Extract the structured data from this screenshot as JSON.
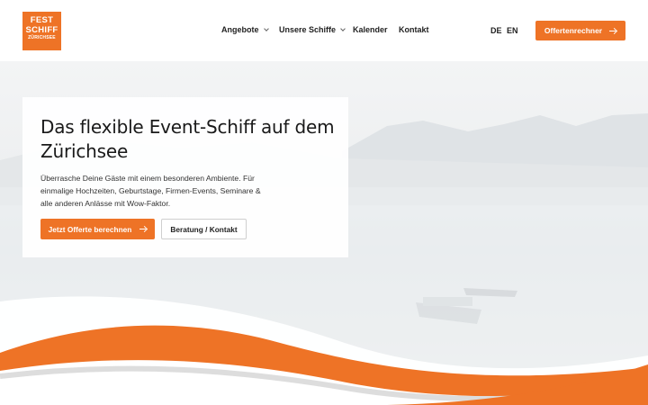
{
  "logo": {
    "line1": "FEST",
    "line2": "SCHIFF",
    "line3": "ZÜRICHSEE"
  },
  "nav": {
    "items": [
      {
        "label": "Angebote",
        "dropdown": true
      },
      {
        "label": "Unsere Schiffe",
        "dropdown": true
      },
      {
        "label": "Kalender",
        "dropdown": false
      },
      {
        "label": "Kontakt",
        "dropdown": false
      }
    ]
  },
  "languages": [
    "DE",
    "EN"
  ],
  "header_cta": "Offertenrechner",
  "hero": {
    "title": "Das flexible Event-Schiff auf dem Zürichsee",
    "text": "Überrasche Deine Gäste mit einem besonderen Ambiente. Für einmalige Hochzeiten, Geburtstage, Firmen-Events, Seminare & alle anderen Anlässe mit Wow-Faktor.",
    "primary_button": "Jetzt Offerte berechnen",
    "secondary_button": "Beratung / Kontakt"
  },
  "colors": {
    "accent": "#ee7326",
    "wave_grey": "#d9d9d9",
    "text": "#1f1f1f"
  }
}
